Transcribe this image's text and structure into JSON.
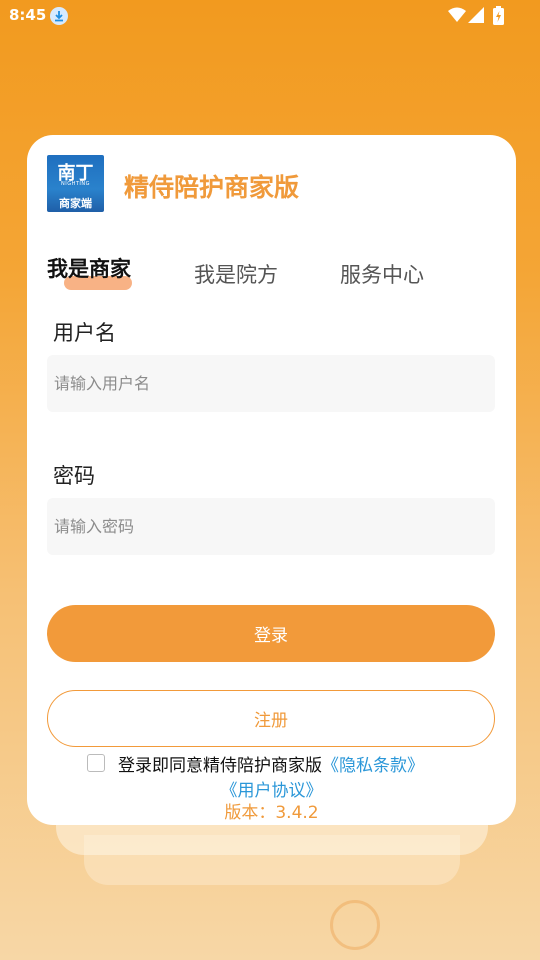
{
  "status_bar": {
    "time": "8:45"
  },
  "app": {
    "title": "精侍陪护商家版",
    "logo_main": "南丁",
    "logo_sub": "NIGHTING",
    "logo_tag": "商家端"
  },
  "tabs": [
    {
      "label": "我是商家",
      "active": true
    },
    {
      "label": "我是院方",
      "active": false
    },
    {
      "label": "服务中心",
      "active": false
    }
  ],
  "form": {
    "username_label": "用户名",
    "username_placeholder": "请输入用户名",
    "username_value": "",
    "password_label": "密码",
    "password_placeholder": "请输入密码",
    "password_value": ""
  },
  "buttons": {
    "login": "登录",
    "register": "注册"
  },
  "agreement": {
    "checked": false,
    "prefix": "登录即同意精侍陪护商家版",
    "privacy_link": "《隐私条款》",
    "user_link": "《用户协议》"
  },
  "version": "版本：3.4.2",
  "colors": {
    "accent": "#f29a3a",
    "link": "#2b97d8",
    "background_top": "#f29a1f"
  }
}
